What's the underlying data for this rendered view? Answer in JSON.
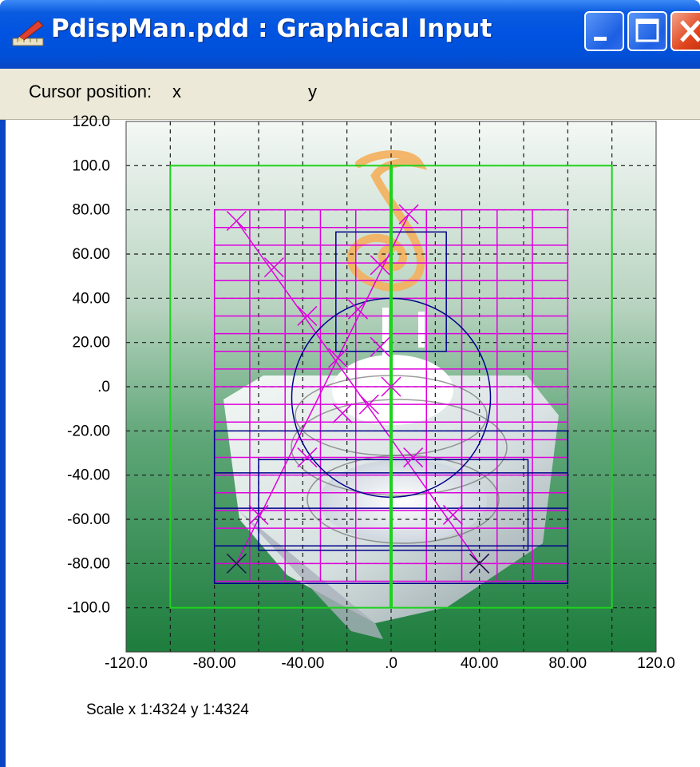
{
  "window": {
    "title": "PdispMan.pdd : Graphical Input",
    "buttons": [
      "minimize-icon",
      "maximize-icon",
      "close-icon"
    ],
    "app_icon": "pencil-ruler-icon"
  },
  "statusbar": {
    "cursor_label": "Cursor position:",
    "x_label": "x",
    "y_label": "y"
  },
  "plot": {
    "scale_text": "Scale x 1:4324  y 1:4324",
    "x_ticks": [
      "-120.0",
      "-80.00",
      "-40.00",
      ".0",
      "40.00",
      "80.00",
      "120.0"
    ],
    "y_ticks": [
      "120.0",
      "100.0",
      "80.00",
      "60.00",
      "40.00",
      "20.00",
      ".0",
      "-20.00",
      "-40.00",
      "-60.00",
      "-80.00",
      "-100.0"
    ],
    "x_range": [
      -120,
      120
    ],
    "y_range": [
      -120,
      120
    ],
    "grid": "dashed",
    "colors": {
      "grid_line": "#1a1a1a",
      "green_frame": "#1ed21e",
      "magenta_grid": "#dd00dd",
      "blue_shapes": "#00008b",
      "background_top": "#f4f8f6",
      "background_bottom": "#1d7d3d",
      "swirl": "#f3b15e"
    }
  },
  "overlays": {
    "green_frame": {
      "x": [
        -100,
        100
      ],
      "y": [
        -100,
        100
      ]
    },
    "green_axis_x": 0,
    "magenta_grid": {
      "x_lines": [
        -80,
        -64,
        -48,
        -32,
        -16,
        0,
        16,
        32,
        48,
        64,
        80
      ],
      "y_lines": [
        80,
        72,
        64,
        56,
        48,
        40,
        32,
        24,
        16,
        8,
        0,
        -8,
        -16,
        -24,
        -32,
        -40,
        -48,
        -56,
        -64,
        -72,
        -80,
        -88
      ]
    },
    "magenta_lines": [
      {
        "from": [
          -70,
          75
        ],
        "to": [
          40,
          -80
        ]
      },
      {
        "from": [
          -70,
          -80
        ],
        "to": [
          8,
          78
        ]
      }
    ],
    "magenta_crosses": [
      [
        -70,
        75
      ],
      [
        -53,
        54
      ],
      [
        -38,
        32
      ],
      [
        -24,
        13
      ],
      [
        -10,
        -8
      ],
      [
        0,
        0
      ],
      [
        -15,
        35
      ],
      [
        8,
        78
      ],
      [
        -5,
        55
      ],
      [
        -60,
        -58
      ],
      [
        -38,
        -32
      ],
      [
        -22,
        -12
      ],
      [
        -5,
        18
      ],
      [
        28,
        -58
      ],
      [
        40,
        -80
      ],
      [
        10,
        -32
      ]
    ],
    "blue_circle": {
      "cx": 0,
      "cy": -5,
      "r": 45
    },
    "blue_rects": [
      {
        "x": [
          -25,
          25
        ],
        "y": [
          16,
          70
        ]
      },
      {
        "x": [
          -60,
          62
        ],
        "y": [
          -74,
          -33
        ]
      },
      {
        "x": [
          -80,
          80
        ],
        "y": [
          -89,
          -20
        ]
      }
    ],
    "blue_h_lines": [
      -39,
      -55,
      -72
    ],
    "black_crosses": [
      [
        -70,
        -80
      ],
      [
        40,
        -80
      ]
    ]
  }
}
